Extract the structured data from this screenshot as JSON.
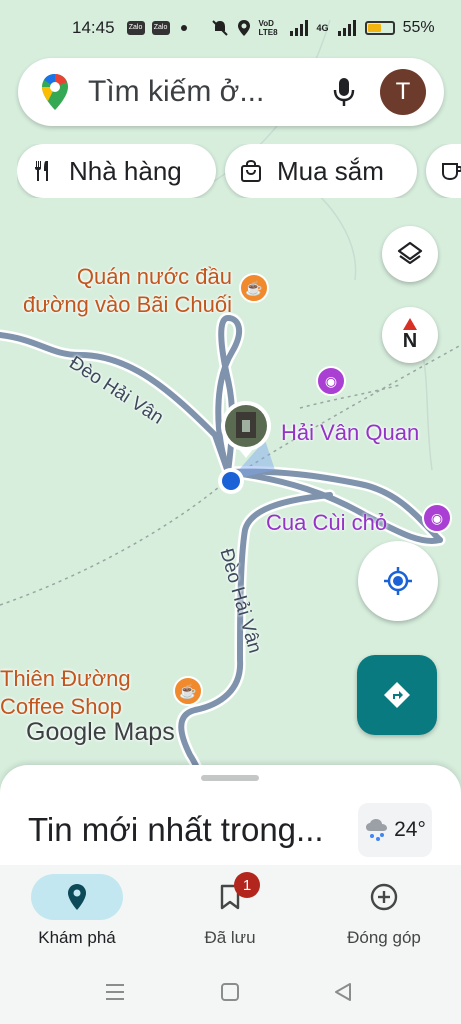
{
  "status_bar": {
    "time": "14:45",
    "app_icon_1": "Zalo",
    "app_icon_2": "Zalo",
    "network_label_1": "VoD LTE8",
    "network_label_2": "4G",
    "battery_percent": "55%",
    "battery_level": 0.55
  },
  "search": {
    "placeholder": "Tìm kiếm ở...",
    "avatar_letter": "T",
    "icons": [
      "google-maps-pin-icon",
      "microphone-icon"
    ]
  },
  "chips": [
    {
      "label": "Nhà hàng",
      "icon": "fork-knife-icon"
    },
    {
      "label": "Mua sắm",
      "icon": "shopping-bag-icon"
    },
    {
      "label": "",
      "icon": "coffee-icon"
    }
  ],
  "map": {
    "places": [
      {
        "name_line1": "Quán nước đầu",
        "name_line2": "đường vào Bãi Chuối",
        "icon": "coffee-icon"
      },
      {
        "name": "Hải Vân Quan",
        "icon": "camera-icon"
      },
      {
        "name": "Cua Cùi chỏ",
        "icon": "camera-icon"
      },
      {
        "name_line1": "Thiên Đường",
        "name_line2": "Coffee Shop",
        "icon": "coffee-icon"
      }
    ],
    "road_labels": [
      "Đèo Hải Vân",
      "Đèo Hải Vân"
    ],
    "brand": "Google Maps",
    "compass_label": "N"
  },
  "sheet": {
    "title": "Tin mới nhất trong...",
    "weather": "24°",
    "weather_icon": "rain-cloud-icon"
  },
  "nav": {
    "items": [
      {
        "label": "Khám phá",
        "icon": "pin-icon",
        "active": true
      },
      {
        "label": "Đã lưu",
        "icon": "bookmark-icon",
        "badge": "1"
      },
      {
        "label": "Đóng góp",
        "icon": "add-circle-icon"
      }
    ]
  },
  "colors": {
    "map_bg": "#d7eedd",
    "road": "#7f93ad",
    "poi_orange": "#f08a2c",
    "poi_purple": "#a93fd3",
    "teal": "#087a80",
    "active_nav": "#c2e7f0"
  }
}
